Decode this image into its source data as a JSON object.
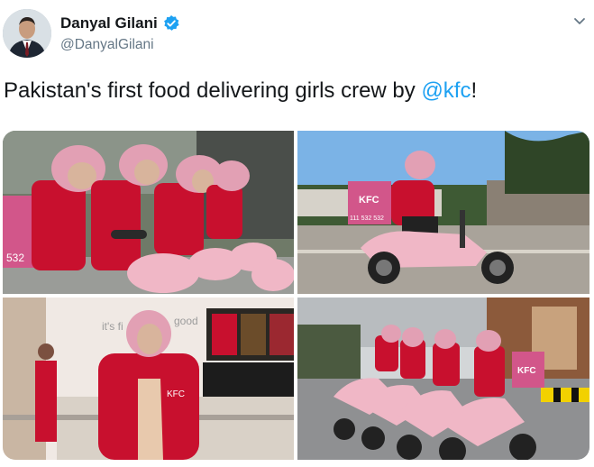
{
  "tweet": {
    "author_name": "Danyal Gilani",
    "handle": "@DanyalGilani",
    "text_before": "Pakistan's first food delivering girls crew by ",
    "mention": "@kfc",
    "text_after": "!"
  },
  "icons": {
    "verified": "verified-badge-icon",
    "menu": "chevron-down-icon"
  },
  "photos": {
    "p1": {
      "box_text": "532"
    },
    "p2": {
      "box_brand": "KFC",
      "box_phone": "111 532 532"
    },
    "p3": {
      "wall_text_left": "it's fi",
      "wall_text_right": "good",
      "jacket_brand": "KFC"
    },
    "p4": {
      "box_brand": "KFC"
    }
  },
  "colors": {
    "accent": "#1da1f2",
    "kfc_red": "#c8102e",
    "helmet_pink": "#e2a0b4",
    "scooter_pink": "#f0b7c6",
    "delivery_box": "#d2568a"
  }
}
